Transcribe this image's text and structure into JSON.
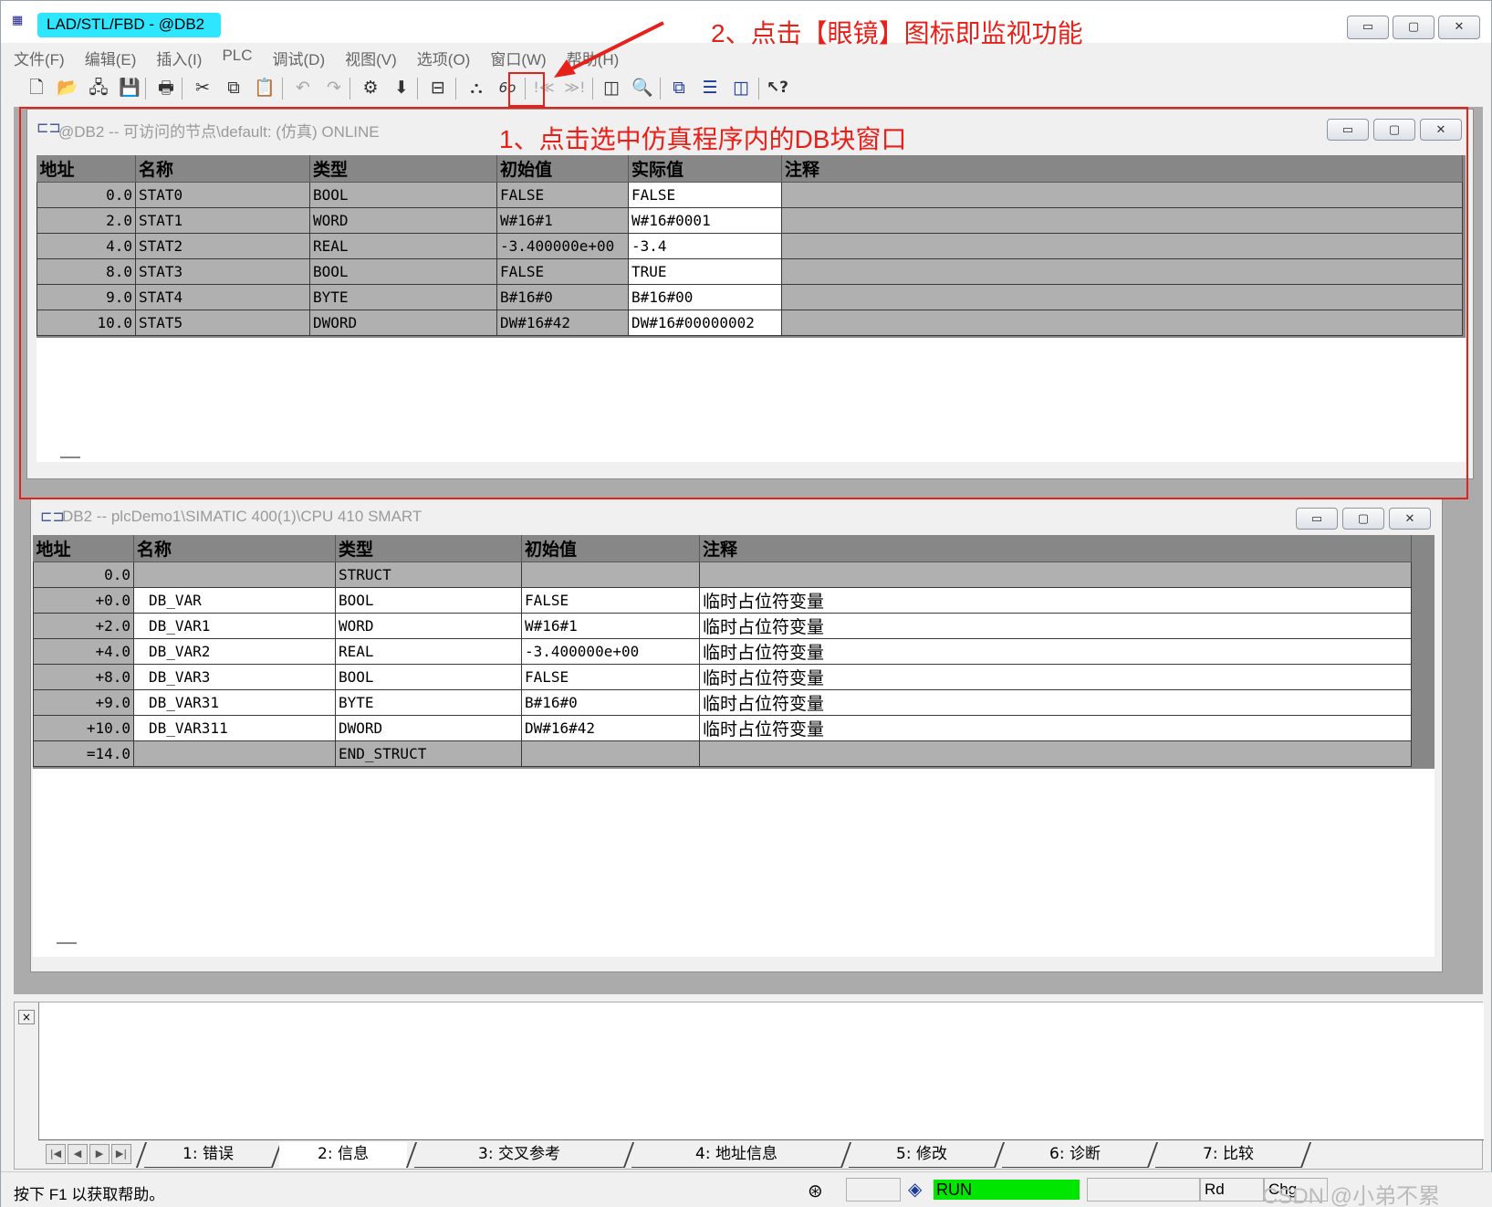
{
  "window": {
    "title": "LAD/STL/FBD  - @DB2",
    "app_icon": "LAD-icon",
    "controls": [
      "▭",
      "▢",
      "✕"
    ]
  },
  "menu": [
    "文件(F)",
    "编辑(E)",
    "插入(I)",
    "PLC",
    "调试(D)",
    "视图(V)",
    "选项(O)",
    "窗口(W)",
    "帮助(H)"
  ],
  "toolbar": {
    "icons": [
      {
        "name": "new-icon",
        "glyph": "🗋"
      },
      {
        "name": "open-icon",
        "glyph": "📂"
      },
      {
        "name": "accessible-nodes-icon",
        "glyph": "🖧"
      },
      {
        "name": "save-icon",
        "glyph": "💾"
      },
      {
        "name": "print-icon",
        "glyph": "🖶"
      },
      {
        "name": "cut-icon",
        "glyph": "✂"
      },
      {
        "name": "copy-icon",
        "glyph": "⧉"
      },
      {
        "name": "paste-icon",
        "glyph": "📋"
      },
      {
        "name": "undo-icon",
        "glyph": "↶"
      },
      {
        "name": "redo-icon",
        "glyph": "↷"
      },
      {
        "name": "compile-icon",
        "glyph": "⚙"
      },
      {
        "name": "download-icon",
        "glyph": "⬇"
      },
      {
        "name": "overview-icon",
        "glyph": "⊟"
      },
      {
        "name": "network-icon",
        "glyph": "⛬"
      },
      {
        "name": "monitor-glasses-icon",
        "glyph": "6o"
      },
      {
        "name": "breakpoint-prev-icon",
        "glyph": "!≪"
      },
      {
        "name": "breakpoint-next-icon",
        "glyph": "≫!"
      },
      {
        "name": "window-split-icon",
        "glyph": "◫"
      },
      {
        "name": "zoom-icon",
        "glyph": "🔍"
      },
      {
        "name": "cascade-icon",
        "glyph": "⧉"
      },
      {
        "name": "tile-horizontal-icon",
        "glyph": "☰"
      },
      {
        "name": "tile-vertical-icon",
        "glyph": "◫"
      },
      {
        "name": "help-pointer-icon",
        "glyph": "↖?"
      }
    ]
  },
  "annotations": {
    "step2": "2、点击【眼镜】图标即监视功能",
    "step1": "1、点击选中仿真程序内的DB块窗口",
    "color": "#e8201a"
  },
  "online_window": {
    "title": "@DB2 -- 可访问的节点\\default:   (仿真)  ONLINE",
    "columns": [
      "地址",
      "名称",
      "类型",
      "初始值",
      "实际值",
      "注释"
    ],
    "rows": [
      {
        "addr": "0.0",
        "name": "STAT0",
        "type": "BOOL",
        "init": "FALSE",
        "actual": "FALSE",
        "comment": ""
      },
      {
        "addr": "2.0",
        "name": "STAT1",
        "type": "WORD",
        "init": "W#16#1",
        "actual": "W#16#0001",
        "comment": ""
      },
      {
        "addr": "4.0",
        "name": "STAT2",
        "type": "REAL",
        "init": "-3.400000e+00",
        "actual": "-3.4",
        "comment": ""
      },
      {
        "addr": "8.0",
        "name": "STAT3",
        "type": "BOOL",
        "init": "FALSE",
        "actual": "TRUE",
        "comment": ""
      },
      {
        "addr": "9.0",
        "name": "STAT4",
        "type": "BYTE",
        "init": "B#16#0",
        "actual": "B#16#00",
        "comment": ""
      },
      {
        "addr": "10.0",
        "name": "STAT5",
        "type": "DWORD",
        "init": "DW#16#42",
        "actual": "DW#16#00000002",
        "comment": ""
      }
    ]
  },
  "offline_window": {
    "title": "DB2 -- plcDemo1\\SIMATIC 400(1)\\CPU 410 SMART",
    "columns": [
      "地址",
      "名称",
      "类型",
      "初始值",
      "注释"
    ],
    "rows": [
      {
        "addr": "0.0",
        "name": "",
        "type": "STRUCT",
        "init": "",
        "comment": "",
        "struct": true
      },
      {
        "addr": "+0.0",
        "name": "DB_VAR",
        "type": "BOOL",
        "init": "FALSE",
        "comment": "临时占位符变量"
      },
      {
        "addr": "+2.0",
        "name": "DB_VAR1",
        "type": "WORD",
        "init": "W#16#1",
        "comment": "临时占位符变量"
      },
      {
        "addr": "+4.0",
        "name": "DB_VAR2",
        "type": "REAL",
        "init": "-3.400000e+00",
        "comment": "临时占位符变量"
      },
      {
        "addr": "+8.0",
        "name": "DB_VAR3",
        "type": "BOOL",
        "init": "FALSE",
        "comment": "临时占位符变量"
      },
      {
        "addr": "+9.0",
        "name": "DB_VAR31",
        "type": "BYTE",
        "init": "B#16#0",
        "comment": "临时占位符变量"
      },
      {
        "addr": "+10.0",
        "name": "DB_VAR311",
        "type": "DWORD",
        "init": "DW#16#42",
        "comment": "临时占位符变量"
      },
      {
        "addr": "=14.0",
        "name": "",
        "type": "END_STRUCT",
        "init": "",
        "comment": "",
        "struct": true
      }
    ]
  },
  "output": {
    "close_glyph": "×",
    "nav": [
      "|◀",
      "◀",
      "▶",
      "▶|"
    ],
    "tabs": [
      "1: 错误",
      "2: 信息",
      "3: 交叉参考",
      "4: 地址信息",
      "5: 修改",
      "6: 诊断",
      "7: 比较"
    ],
    "active_tab": 1
  },
  "status": {
    "help": "按下 F1 以获取帮助。",
    "run": "RUN",
    "rd": "Rd",
    "chg": "Chg",
    "run_color": "#00e600",
    "watermark": "CSDN @小弟不累"
  }
}
